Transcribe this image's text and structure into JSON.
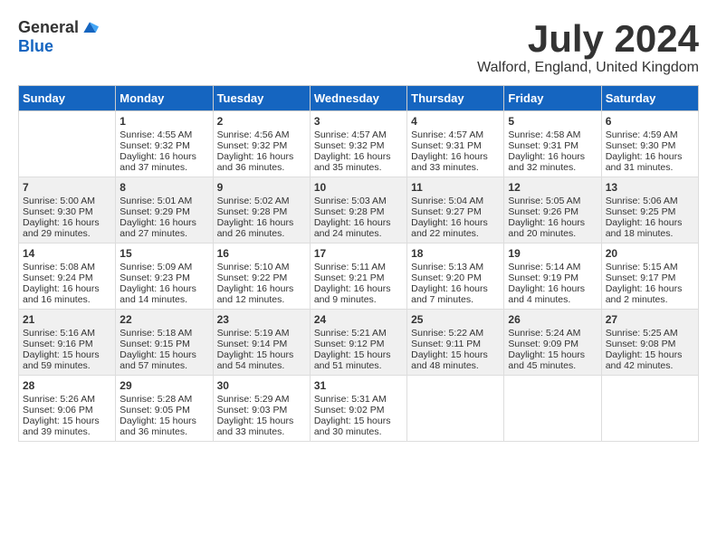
{
  "logo": {
    "general": "General",
    "blue": "Blue"
  },
  "title": "July 2024",
  "location": "Walford, England, United Kingdom",
  "weekdays": [
    "Sunday",
    "Monday",
    "Tuesday",
    "Wednesday",
    "Thursday",
    "Friday",
    "Saturday"
  ],
  "weeks": [
    [
      {
        "day": "",
        "content": ""
      },
      {
        "day": "1",
        "content": "Sunrise: 4:55 AM\nSunset: 9:32 PM\nDaylight: 16 hours\nand 37 minutes."
      },
      {
        "day": "2",
        "content": "Sunrise: 4:56 AM\nSunset: 9:32 PM\nDaylight: 16 hours\nand 36 minutes."
      },
      {
        "day": "3",
        "content": "Sunrise: 4:57 AM\nSunset: 9:32 PM\nDaylight: 16 hours\nand 35 minutes."
      },
      {
        "day": "4",
        "content": "Sunrise: 4:57 AM\nSunset: 9:31 PM\nDaylight: 16 hours\nand 33 minutes."
      },
      {
        "day": "5",
        "content": "Sunrise: 4:58 AM\nSunset: 9:31 PM\nDaylight: 16 hours\nand 32 minutes."
      },
      {
        "day": "6",
        "content": "Sunrise: 4:59 AM\nSunset: 9:30 PM\nDaylight: 16 hours\nand 31 minutes."
      }
    ],
    [
      {
        "day": "7",
        "content": "Sunrise: 5:00 AM\nSunset: 9:30 PM\nDaylight: 16 hours\nand 29 minutes."
      },
      {
        "day": "8",
        "content": "Sunrise: 5:01 AM\nSunset: 9:29 PM\nDaylight: 16 hours\nand 27 minutes."
      },
      {
        "day": "9",
        "content": "Sunrise: 5:02 AM\nSunset: 9:28 PM\nDaylight: 16 hours\nand 26 minutes."
      },
      {
        "day": "10",
        "content": "Sunrise: 5:03 AM\nSunset: 9:28 PM\nDaylight: 16 hours\nand 24 minutes."
      },
      {
        "day": "11",
        "content": "Sunrise: 5:04 AM\nSunset: 9:27 PM\nDaylight: 16 hours\nand 22 minutes."
      },
      {
        "day": "12",
        "content": "Sunrise: 5:05 AM\nSunset: 9:26 PM\nDaylight: 16 hours\nand 20 minutes."
      },
      {
        "day": "13",
        "content": "Sunrise: 5:06 AM\nSunset: 9:25 PM\nDaylight: 16 hours\nand 18 minutes."
      }
    ],
    [
      {
        "day": "14",
        "content": "Sunrise: 5:08 AM\nSunset: 9:24 PM\nDaylight: 16 hours\nand 16 minutes."
      },
      {
        "day": "15",
        "content": "Sunrise: 5:09 AM\nSunset: 9:23 PM\nDaylight: 16 hours\nand 14 minutes."
      },
      {
        "day": "16",
        "content": "Sunrise: 5:10 AM\nSunset: 9:22 PM\nDaylight: 16 hours\nand 12 minutes."
      },
      {
        "day": "17",
        "content": "Sunrise: 5:11 AM\nSunset: 9:21 PM\nDaylight: 16 hours\nand 9 minutes."
      },
      {
        "day": "18",
        "content": "Sunrise: 5:13 AM\nSunset: 9:20 PM\nDaylight: 16 hours\nand 7 minutes."
      },
      {
        "day": "19",
        "content": "Sunrise: 5:14 AM\nSunset: 9:19 PM\nDaylight: 16 hours\nand 4 minutes."
      },
      {
        "day": "20",
        "content": "Sunrise: 5:15 AM\nSunset: 9:17 PM\nDaylight: 16 hours\nand 2 minutes."
      }
    ],
    [
      {
        "day": "21",
        "content": "Sunrise: 5:16 AM\nSunset: 9:16 PM\nDaylight: 15 hours\nand 59 minutes."
      },
      {
        "day": "22",
        "content": "Sunrise: 5:18 AM\nSunset: 9:15 PM\nDaylight: 15 hours\nand 57 minutes."
      },
      {
        "day": "23",
        "content": "Sunrise: 5:19 AM\nSunset: 9:14 PM\nDaylight: 15 hours\nand 54 minutes."
      },
      {
        "day": "24",
        "content": "Sunrise: 5:21 AM\nSunset: 9:12 PM\nDaylight: 15 hours\nand 51 minutes."
      },
      {
        "day": "25",
        "content": "Sunrise: 5:22 AM\nSunset: 9:11 PM\nDaylight: 15 hours\nand 48 minutes."
      },
      {
        "day": "26",
        "content": "Sunrise: 5:24 AM\nSunset: 9:09 PM\nDaylight: 15 hours\nand 45 minutes."
      },
      {
        "day": "27",
        "content": "Sunrise: 5:25 AM\nSunset: 9:08 PM\nDaylight: 15 hours\nand 42 minutes."
      }
    ],
    [
      {
        "day": "28",
        "content": "Sunrise: 5:26 AM\nSunset: 9:06 PM\nDaylight: 15 hours\nand 39 minutes."
      },
      {
        "day": "29",
        "content": "Sunrise: 5:28 AM\nSunset: 9:05 PM\nDaylight: 15 hours\nand 36 minutes."
      },
      {
        "day": "30",
        "content": "Sunrise: 5:29 AM\nSunset: 9:03 PM\nDaylight: 15 hours\nand 33 minutes."
      },
      {
        "day": "31",
        "content": "Sunrise: 5:31 AM\nSunset: 9:02 PM\nDaylight: 15 hours\nand 30 minutes."
      },
      {
        "day": "",
        "content": ""
      },
      {
        "day": "",
        "content": ""
      },
      {
        "day": "",
        "content": ""
      }
    ]
  ]
}
